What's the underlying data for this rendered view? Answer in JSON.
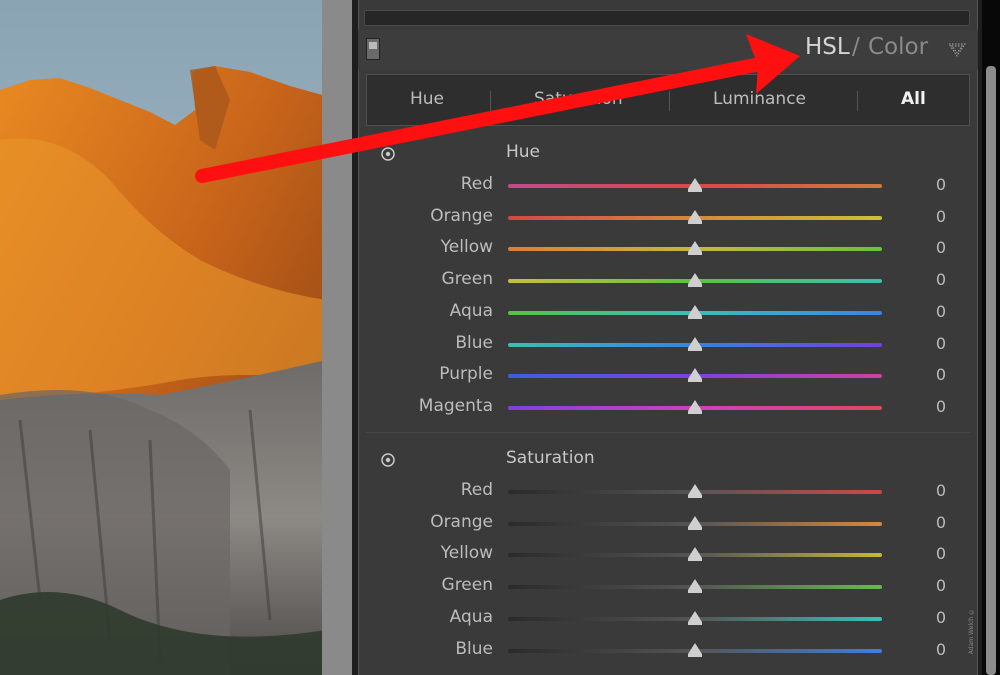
{
  "panel": {
    "title_main": "HSL",
    "title_separator": "/",
    "title_secondary": "Color"
  },
  "tabs": [
    {
      "label": "Hue",
      "active": false
    },
    {
      "label": "Saturation",
      "active": false
    },
    {
      "label": "Luminance",
      "active": false
    },
    {
      "label": "All",
      "active": true
    }
  ],
  "sections": [
    {
      "title": "Hue",
      "rows": [
        {
          "label": "Red",
          "value": "0",
          "slider_level": 0.5
        },
        {
          "label": "Orange",
          "value": "0",
          "slider_level": 0.5
        },
        {
          "label": "Yellow",
          "value": "0",
          "slider_level": 0.5
        },
        {
          "label": "Green",
          "value": "0",
          "slider_level": 0.5
        },
        {
          "label": "Aqua",
          "value": "0",
          "slider_level": 0.5
        },
        {
          "label": "Blue",
          "value": "0",
          "slider_level": 0.5
        },
        {
          "label": "Purple",
          "value": "0",
          "slider_level": 0.5
        },
        {
          "label": "Magenta",
          "value": "0",
          "slider_level": 0.5
        }
      ]
    },
    {
      "title": "Saturation",
      "rows": [
        {
          "label": "Red",
          "value": "0",
          "slider_level": 0.5
        },
        {
          "label": "Orange",
          "value": "0",
          "slider_level": 0.5
        },
        {
          "label": "Yellow",
          "value": "0",
          "slider_level": 0.5
        },
        {
          "label": "Green",
          "value": "0",
          "slider_level": 0.5
        },
        {
          "label": "Aqua",
          "value": "0",
          "slider_level": 0.5
        },
        {
          "label": "Blue",
          "value": "0",
          "slider_level": 0.5
        }
      ]
    }
  ],
  "watermark": "Adam Welch ©",
  "colors": {
    "annotation_arrow": "#ff1010",
    "panel_bg": "#3a3a3a"
  }
}
